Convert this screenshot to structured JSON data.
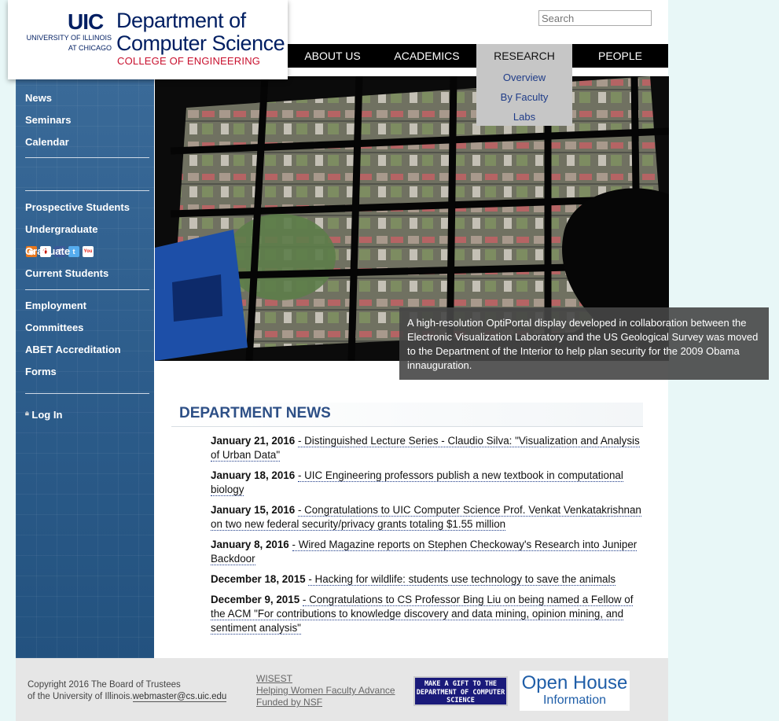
{
  "header": {
    "logo_uic": "UIC",
    "logo_university": "UNIVERSITY OF ILLINOIS AT CHICAGO",
    "logo_dept_line1": "Department of",
    "logo_dept_line2": "Computer Science",
    "logo_college": "COLLEGE OF ENGINEERING",
    "search_placeholder": "Search"
  },
  "nav": {
    "items": [
      "ABOUT US",
      "ACADEMICS",
      "RESEARCH",
      "PEOPLE"
    ],
    "active": "RESEARCH",
    "dropdown": [
      "Overview",
      "By Faculty",
      "Labs"
    ]
  },
  "sidebar": {
    "group1": [
      "News",
      "Seminars",
      "Calendar"
    ],
    "social_icons": [
      "rss-icon",
      "yelp-icon",
      "facebook-icon",
      "twitter-icon",
      "youtube-icon"
    ],
    "group2": [
      "Prospective Students",
      "Undergraduate",
      "Graduate",
      "Current Students"
    ],
    "group3": [
      "Employment",
      "Committees",
      "ABET Accreditation",
      "Forms"
    ],
    "login": "Log In"
  },
  "hero": {
    "caption": "A high-resolution OptiPortal display developed in collaboration between the Electronic Visualization Laboratory and the US Geological Survey was moved to the Department of the Interior to help plan security for the 2009 Obama innauguration."
  },
  "news": {
    "title": "DEPARTMENT NEWS",
    "items": [
      {
        "date": "January 21, 2016",
        "text": "Distinguished Lecture Series - Claudio Silva: \"Visualization and Analysis of Urban Data\""
      },
      {
        "date": "January 18, 2016",
        "text": "UIC Engineering professors publish a new textbook in computational biology"
      },
      {
        "date": "January 15, 2016",
        "text": "Congratulations to UIC Computer Science Prof. Venkat Venkatakrishnan on two new federal security/privacy grants totaling $1.55 million"
      },
      {
        "date": "January 8, 2016",
        "text": "Wired Magazine reports on Stephen Checkoway's Research into Juniper Backdoor"
      },
      {
        "date": "December 18, 2015",
        "text": "Hacking for wildlife: students use technology to save the animals"
      },
      {
        "date": "December 9, 2015",
        "text": "Congratulations to CS Professor Bing Liu on being named a Fellow of the ACM \"For contributions to knowledge discovery and data mining, opinion mining, and sentiment analysis\""
      }
    ]
  },
  "footer": {
    "copyright_line1": "Copyright 2016 The Board of Trustees",
    "copyright_line2": "of the University of Illinois.",
    "email": "webmaster@cs.uic.edu",
    "wisest": [
      "WISEST",
      "Helping Women Faculty Advance",
      "Funded by NSF"
    ],
    "gift": "MAKE A GIFT TO THE DEPARTMENT OF COMPUTER SCIENCE",
    "openhouse_line1": "Open House",
    "openhouse_line2": "Information"
  },
  "colors": {
    "brand_navy": "#001e62",
    "brand_red": "#c8102e",
    "link_blue": "#1f3c88",
    "news_title": "#2d4f86",
    "sidebar": "#2f5f8e"
  }
}
